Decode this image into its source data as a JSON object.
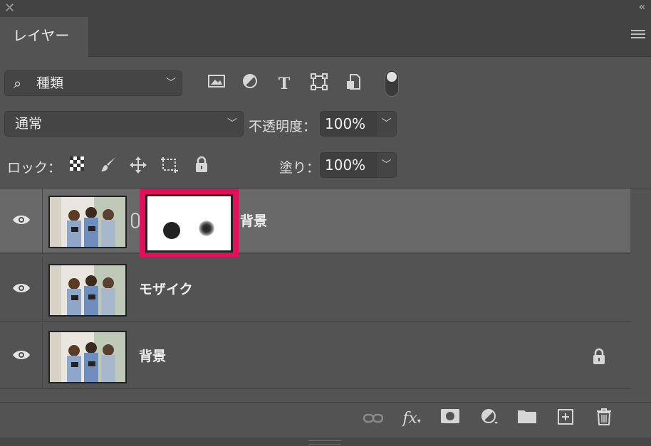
{
  "panel": {
    "tab_label": "レイヤー"
  },
  "filter": {
    "selected": "種類",
    "icons": [
      "image-icon",
      "adjustment-icon",
      "type-icon",
      "shape-icon",
      "smart-object-icon"
    ]
  },
  "blend": {
    "mode": "通常",
    "opacity_label": "不透明度：",
    "opacity_value": "100%"
  },
  "lock": {
    "label": "ロック：",
    "fill_label": "塗り：",
    "fill_value": "100%"
  },
  "layers": [
    {
      "name": "背景",
      "selected": true,
      "has_mask": true,
      "locked": false
    },
    {
      "name": "モザイク",
      "selected": false,
      "has_mask": false,
      "locked": false
    },
    {
      "name": "背景",
      "selected": false,
      "has_mask": false,
      "locked": true
    }
  ],
  "colors": {
    "panel_bg": "#535353",
    "selected_row": "#696969",
    "highlight": "#e0105b"
  },
  "bottom_icons": [
    "link-icon",
    "fx-icon",
    "mask-icon",
    "adjustment-layer-icon",
    "folder-icon",
    "new-layer-icon",
    "trash-icon"
  ]
}
